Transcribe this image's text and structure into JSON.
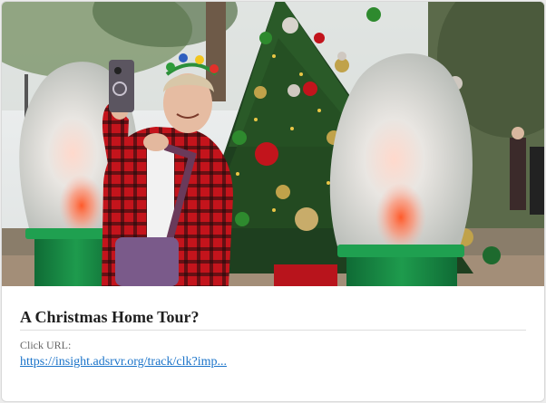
{
  "card": {
    "title": "A Christmas Home Tour?",
    "url_label": "Click URL:",
    "url_text": "https://insight.adsrvr.org/track/clk?imp..."
  },
  "image": {
    "alt": "Woman in red plaid shirt taking a selfie in front of a decorated Christmas tree between two giant light-bulb decorations"
  }
}
